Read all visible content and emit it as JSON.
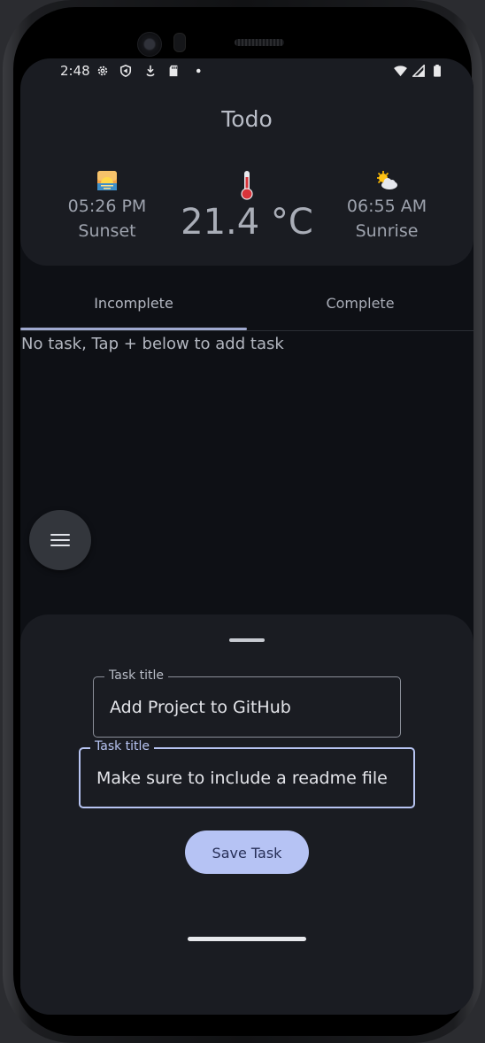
{
  "status_bar": {
    "time": "2:48",
    "icons": [
      "settings-icon",
      "shield-icon",
      "download-icon",
      "sd-card-icon",
      "dot-icon",
      "wifi-icon",
      "signal-icon",
      "battery-icon"
    ]
  },
  "app": {
    "title": "Todo"
  },
  "weather": {
    "sunset": {
      "time": "05:26 PM",
      "label": "Sunset",
      "emoji": "🌅"
    },
    "temperature": {
      "value": "21.4 °C",
      "emoji": "🌡️"
    },
    "sunrise": {
      "time": "06:55 AM",
      "label": "Sunrise",
      "emoji": "🌤️"
    }
  },
  "tabs": [
    {
      "label": "Incomplete",
      "active": true
    },
    {
      "label": "Complete",
      "active": false
    }
  ],
  "empty_message": "No task, Tap + below to add task",
  "sheet": {
    "fields": [
      {
        "label": "Task title",
        "value": "Add Project to GitHub"
      },
      {
        "label": "Task title",
        "value": "Make sure to include a readme file"
      }
    ],
    "save_label": "Save Task"
  },
  "colors": {
    "background": "#0e1015",
    "surface": "#1a1c22",
    "accent": "#b6c3f4",
    "accent_text": "#283058"
  }
}
